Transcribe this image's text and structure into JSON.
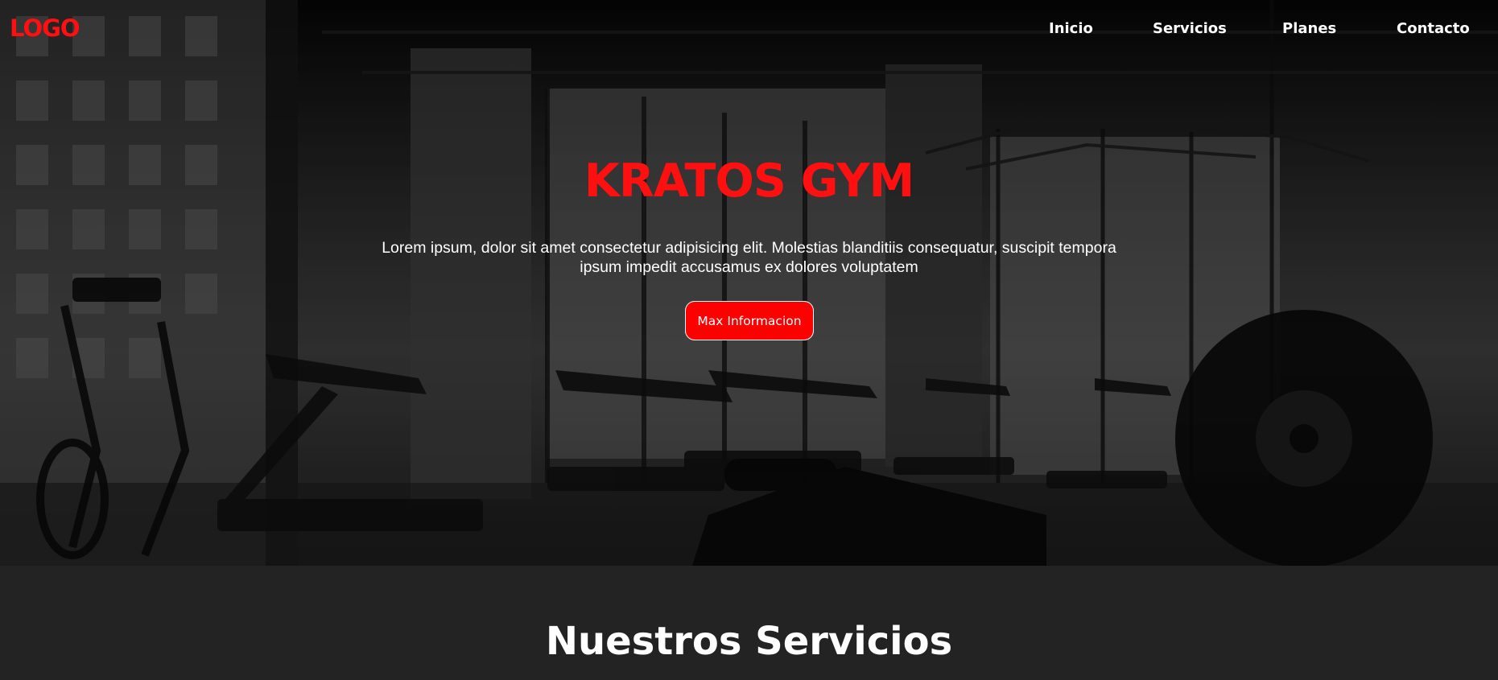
{
  "header": {
    "logo": "LOGO",
    "nav": [
      {
        "label": "Inicio"
      },
      {
        "label": "Servicios"
      },
      {
        "label": "Planes"
      },
      {
        "label": "Contacto"
      }
    ]
  },
  "hero": {
    "title": "KRATOS GYM",
    "description": "Lorem ipsum, dolor sit amet consectetur adipisicing elit. Molestias blanditiis consequatur, suscipit tempora ipsum impedit accusamus ex dolores voluptatem",
    "button_label": "Max Informacion"
  },
  "services": {
    "title": "Nuestros Servicios"
  },
  "colors": {
    "accent": "#ff0000",
    "dark_background": "#232323",
    "text": "#ffffff"
  }
}
